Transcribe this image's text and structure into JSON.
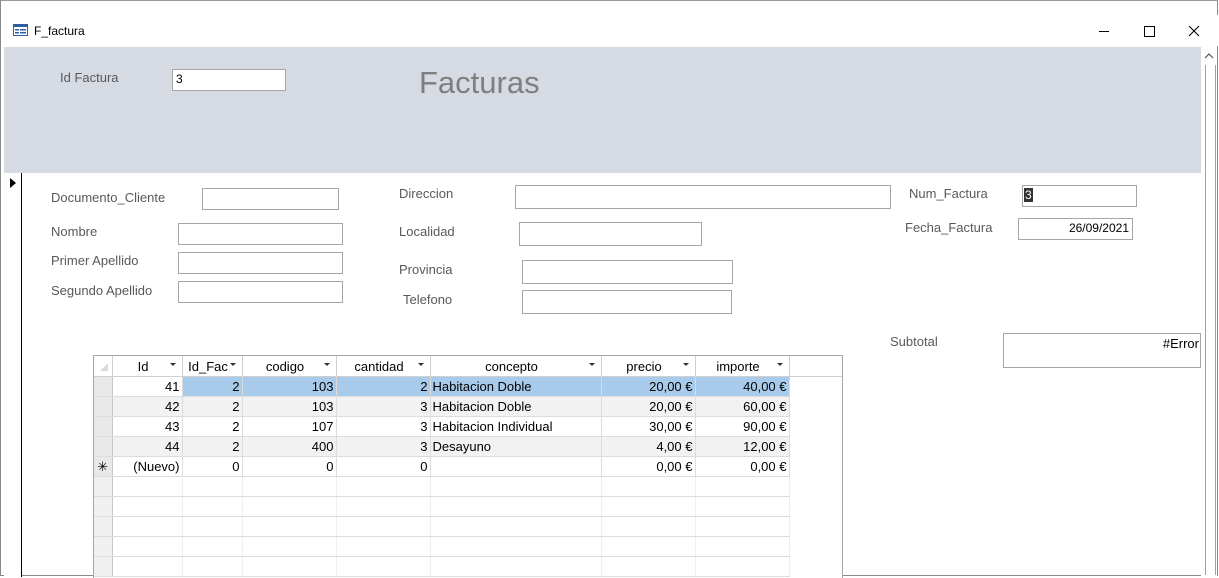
{
  "window": {
    "title": "F_factura"
  },
  "header": {
    "id_factura_label": "Id Factura",
    "id_factura_value": "3",
    "form_title": "Facturas"
  },
  "fields": {
    "documento_cliente": {
      "label": "Documento_Cliente",
      "value": ""
    },
    "nombre": {
      "label": "Nombre",
      "value": ""
    },
    "primer_apellido": {
      "label": "Primer Apellido",
      "value": ""
    },
    "segundo_apellido": {
      "label": "Segundo Apellido",
      "value": ""
    },
    "direccion": {
      "label": "Direccion",
      "value": ""
    },
    "localidad": {
      "label": "Localidad",
      "value": ""
    },
    "provincia": {
      "label": "Provincia",
      "value": ""
    },
    "telefono": {
      "label": "Telefono",
      "value": ""
    },
    "num_factura": {
      "label": "Num_Factura",
      "value": "3"
    },
    "fecha_factura": {
      "label": "Fecha_Factura",
      "value": "26/09/2021"
    },
    "subtotal": {
      "label": "Subtotal",
      "value": "#Error"
    }
  },
  "subform": {
    "columns": [
      "Id",
      "Id_Fac",
      "codigo",
      "cantidad",
      "concepto",
      "precio",
      "importe"
    ],
    "rows": [
      [
        "41",
        "2",
        "103",
        "2",
        "Habitacion Doble",
        "20,00 €",
        "40,00 €"
      ],
      [
        "42",
        "2",
        "103",
        "3",
        "Habitacion Doble",
        "20,00 €",
        "60,00 €"
      ],
      [
        "43",
        "2",
        "107",
        "3",
        "Habitacion Individual",
        "30,00 €",
        "90,00 €"
      ],
      [
        "44",
        "2",
        "400",
        "3",
        "Desayuno",
        "4,00 €",
        "12,00 €"
      ]
    ],
    "new_row": [
      "(Nuevo)",
      "0",
      "0",
      "0",
      "",
      "0,00 €",
      "0,00 €"
    ],
    "selected_row": 0
  },
  "colors": {
    "header_bg": "#d5dae3",
    "row_highlight": "#a9cbeb"
  }
}
